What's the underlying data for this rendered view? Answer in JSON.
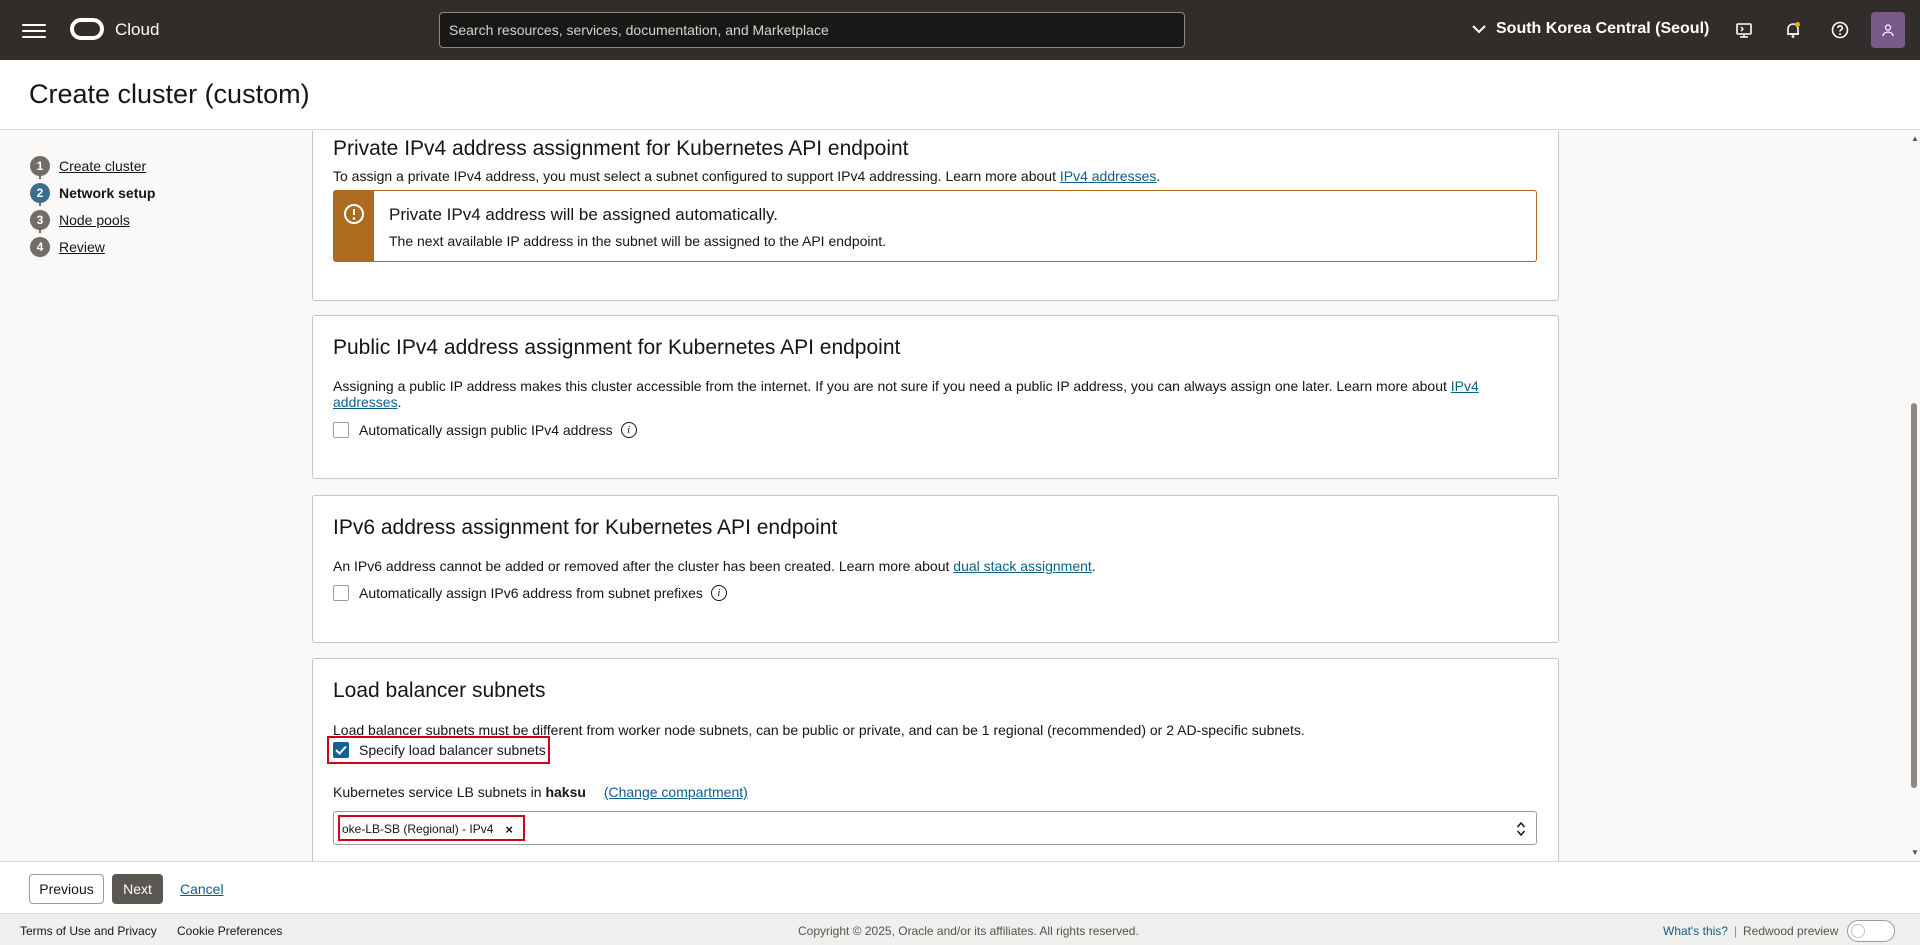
{
  "topbar": {
    "brand": "Cloud",
    "search_placeholder": "Search resources, services, documentation, and Marketplace",
    "region": "South Korea Central (Seoul)"
  },
  "page": {
    "title": "Create cluster (custom)"
  },
  "steps": [
    {
      "num": "1",
      "label": "Create cluster",
      "active": false
    },
    {
      "num": "2",
      "label": "Network setup",
      "active": true
    },
    {
      "num": "3",
      "label": "Node pools",
      "active": false
    },
    {
      "num": "4",
      "label": "Review",
      "active": false
    }
  ],
  "private_ipv4": {
    "title": "Private IPv4 address assignment for Kubernetes API endpoint",
    "desc": "To assign a private IPv4 address, you must select a subnet configured to support IPv4 addressing. Learn more about ",
    "link": "IPv4 addresses",
    "notice_title": "Private IPv4 address will be assigned automatically.",
    "notice_body": "The next available IP address in the subnet will be assigned to the API endpoint."
  },
  "public_ipv4": {
    "title": "Public IPv4 address assignment for Kubernetes API endpoint",
    "desc": "Assigning a public IP address makes this cluster accessible from the internet. If you are not sure if you need a public IP address, you can always assign one later. Learn more about ",
    "link": "IPv4 addresses",
    "checkbox_label": "Automatically assign public IPv4 address",
    "checked": false
  },
  "ipv6": {
    "title": "IPv6 address assignment for Kubernetes API endpoint",
    "desc": "An IPv6 address cannot be added or removed after the cluster has been created. Learn more about ",
    "link": "dual stack assignment",
    "checkbox_label": "Automatically assign IPv6 address from subnet prefixes",
    "checked": false
  },
  "lb_subnets": {
    "title": "Load balancer subnets",
    "desc": "Load balancer subnets must be different from worker node subnets, can be public or private, and can be 1 regional (recommended) or 2 AD-specific subnets.",
    "checkbox_label": "Specify load balancer subnets",
    "checked": true,
    "field_label_prefix": "Kubernetes service LB subnets in ",
    "compartment": "haksu",
    "change_compartment": "(Change compartment)",
    "selected_chip": "oke-LB-SB (Regional) - IPv4"
  },
  "actions": {
    "previous": "Previous",
    "next": "Next",
    "cancel": "Cancel"
  },
  "footer": {
    "terms": "Terms of Use and Privacy",
    "cookies": "Cookie Preferences",
    "copyright": "Copyright © 2025, Oracle and/or its affiliates. All rights reserved.",
    "whats_this": "What's this?",
    "separator": "|",
    "redwood": "Redwood preview"
  }
}
